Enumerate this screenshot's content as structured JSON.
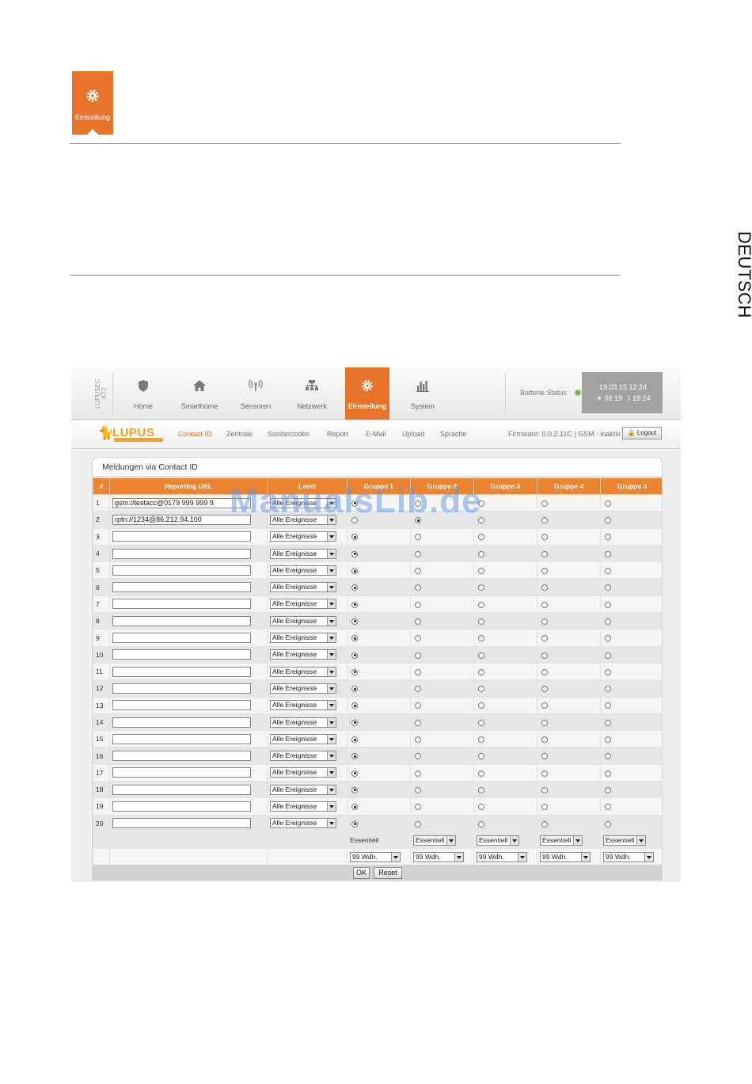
{
  "page": {
    "icon_label": "Einstellung",
    "side_tab": "DEUTSCH",
    "watermark": "ManualsLib.de"
  },
  "app": {
    "brand_vertical": "LUPUSEC XT2",
    "nav": [
      {
        "label": "Home",
        "icon": "shield-icon"
      },
      {
        "label": "Smarthome",
        "icon": "house-icon"
      },
      {
        "label": "Sensoren",
        "icon": "antenna-icon"
      },
      {
        "label": "Netzwerk",
        "icon": "network-icon"
      },
      {
        "label": "Einstellung",
        "icon": "gear-icon"
      },
      {
        "label": "System",
        "icon": "bars-icon"
      }
    ],
    "battery_label": "Batterie Status",
    "datetime": "19.03.15 12:24",
    "sun_times": "☀ 06:19 ☽ 18:24",
    "logo_text": "LUPUS",
    "subnav": [
      "Contact ID",
      "Zentrale",
      "Sondercodes",
      "Report",
      "E-Mail",
      "Upload",
      "Sprache"
    ],
    "firmware": "Firmware: 0.0.2.11C | GSM : inaktiv",
    "logout": "Logout"
  },
  "panel": {
    "title": "Meldungen via Contact ID",
    "headers": [
      "#",
      "Reporting URL",
      "Level",
      "Gruppe 1",
      "Gruppe 2",
      "Gruppe 3",
      "Gruppe 4",
      "Gruppe 5"
    ],
    "rows": [
      {
        "num": "1",
        "url": "gsm://testacc@0179 999 999 9",
        "level": "Alle Ereignisse",
        "group": 1
      },
      {
        "num": "2",
        "url": "rptn://1234@86.212.94.100",
        "level": "Alle Ereignisse",
        "group": 2
      },
      {
        "num": "3",
        "url": "",
        "level": "Alle Ereignisse",
        "group": 1
      },
      {
        "num": "4",
        "url": "",
        "level": "Alle Ereignisse",
        "group": 1
      },
      {
        "num": "5",
        "url": "",
        "level": "Alle Ereignisse",
        "group": 1
      },
      {
        "num": "6",
        "url": "",
        "level": "Alle Ereignisse",
        "group": 1
      },
      {
        "num": "7",
        "url": "",
        "level": "Alle Ereignisse",
        "group": 1
      },
      {
        "num": "8",
        "url": "",
        "level": "Alle Ereignisse",
        "group": 1
      },
      {
        "num": "9",
        "url": "",
        "level": "Alle Ereignisse",
        "group": 1
      },
      {
        "num": "10",
        "url": "",
        "level": "Alle Ereignisse",
        "group": 1
      },
      {
        "num": "11",
        "url": "",
        "level": "Alle Ereignisse",
        "group": 1
      },
      {
        "num": "12",
        "url": "",
        "level": "Alle Ereignisse",
        "group": 1
      },
      {
        "num": "13",
        "url": "",
        "level": "Alle Ereignisse",
        "group": 1
      },
      {
        "num": "14",
        "url": "",
        "level": "Alle Ereignisse",
        "group": 1
      },
      {
        "num": "15",
        "url": "",
        "level": "Alle Ereignisse",
        "group": 1
      },
      {
        "num": "16",
        "url": "",
        "level": "Alle Ereignisse",
        "group": 1
      },
      {
        "num": "17",
        "url": "",
        "level": "Alle Ereignisse",
        "group": 1
      },
      {
        "num": "18",
        "url": "",
        "level": "Alle Ereignisse",
        "group": 1
      },
      {
        "num": "19",
        "url": "",
        "level": "Alle Ereignisse",
        "group": 1
      },
      {
        "num": "20",
        "url": "",
        "level": "Alle Ereignisse",
        "group": 1
      }
    ],
    "group1_type_text": "Essentiell",
    "group_types": [
      "Essentiell",
      "Essentiell",
      "Essentiell",
      "Essentiell"
    ],
    "repeat_values": [
      "99 Wdh.",
      "99 Wdh.",
      "99 Wdh.",
      "99 Wdh.",
      "99 Wdh."
    ],
    "ok": "OK",
    "reset": "Reset"
  }
}
